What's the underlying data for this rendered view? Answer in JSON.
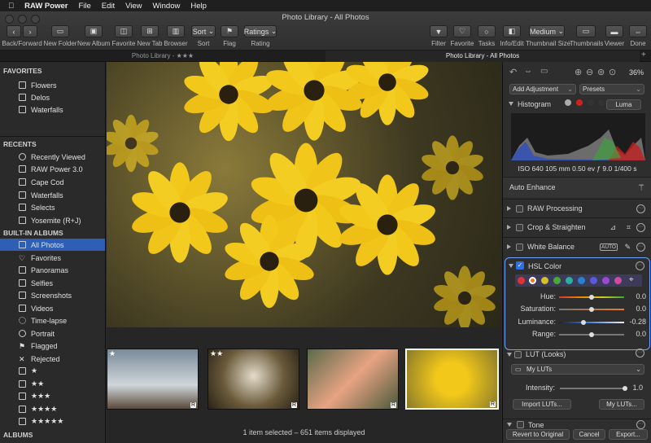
{
  "menubar": {
    "app": "RAW Power",
    "items": [
      "File",
      "Edit",
      "View",
      "Window",
      "Help"
    ]
  },
  "window": {
    "title": "Photo Library - All Photos"
  },
  "toolbar": {
    "back_forward": "Back/Forward",
    "new_folder": "New Folder",
    "new_album": "New Album",
    "favorite": "Favorite",
    "new_tab": "New Tab",
    "browser": "Browser",
    "sort_btn": "Sort",
    "sort": "Sort",
    "flag": "Flag",
    "ratings_btn": "Ratings",
    "rating": "Rating",
    "filter": "Filter",
    "favorite_r": "Favorite",
    "tasks": "Tasks",
    "info_edit": "Info/Edit",
    "thumb_size_btn": "Medium",
    "thumb_size": "Thumbnail Size",
    "thumbnails": "Thumbnails",
    "viewer": "Viewer",
    "done": "Done"
  },
  "tabs": [
    "Photo Library - ★★★",
    "Photo Library - All Photos"
  ],
  "sidebar": {
    "favorites_header": "FAVORITES",
    "favorites": [
      "Flowers",
      "Delos",
      "Waterfalls"
    ],
    "recents_header": "RECENTS",
    "recents": [
      "Recently Viewed",
      "RAW Power 3.0",
      "Cape Cod",
      "Waterfalls",
      "Selects",
      "Yosemite (R+J)"
    ],
    "builtin_header": "BUILT-IN ALBUMS",
    "builtin": [
      "All Photos",
      "Favorites",
      "Panoramas",
      "Selfies",
      "Screenshots",
      "Videos",
      "Time-lapse",
      "Portrait",
      "Flagged",
      "Rejected",
      "★",
      "★★",
      "★★★",
      "★★★★",
      "★★★★★"
    ],
    "albums_header": "ALBUMS"
  },
  "filmstrip": {
    "thumbs": [
      {
        "stars": "★",
        "badge": "R"
      },
      {
        "stars": "★★",
        "badge": "R"
      },
      {
        "stars": "",
        "badge": "R"
      },
      {
        "stars": "",
        "badge": "R"
      }
    ]
  },
  "status": "1 item selected – 651 items displayed",
  "panel": {
    "zoom": "36%",
    "add_adjustment": "Add Adjustment",
    "presets": "Presets",
    "histogram": "Histogram",
    "luma": "Luma",
    "exif": "ISO 640   105 mm   0.50 ev   ƒ 9.0   1/400 s",
    "auto_enhance": "Auto Enhance",
    "raw_processing": "RAW Processing",
    "crop": "Crop & Straighten",
    "white_balance": "White Balance",
    "auto": "AUTO",
    "hsl": "HSL Color",
    "hsl_labels": {
      "hue": "Hue:",
      "saturation": "Saturation:",
      "luminance": "Luminance:",
      "range": "Range:"
    },
    "hsl_values": {
      "hue": "0.0",
      "saturation": "0.0",
      "luminance": "-0.28",
      "range": "0.0"
    },
    "hsl_levels": {
      "hue": 0.5,
      "saturation": 0.5,
      "luminance": 0.38,
      "range": 0.5
    },
    "lut": "LUT (Looks)",
    "my_luts": "My LUTs",
    "intensity": "Intensity:",
    "intensity_value": "1.0",
    "intensity_level": 1.0,
    "import_luts": "Import LUTs...",
    "my_luts_btn": "My LUTs...",
    "tone": "Tone",
    "revert": "Revert to Original",
    "cancel": "Cancel",
    "export": "Export..."
  },
  "colors": {
    "accent": "#2f5fb4",
    "flower": "#f2c81a"
  }
}
